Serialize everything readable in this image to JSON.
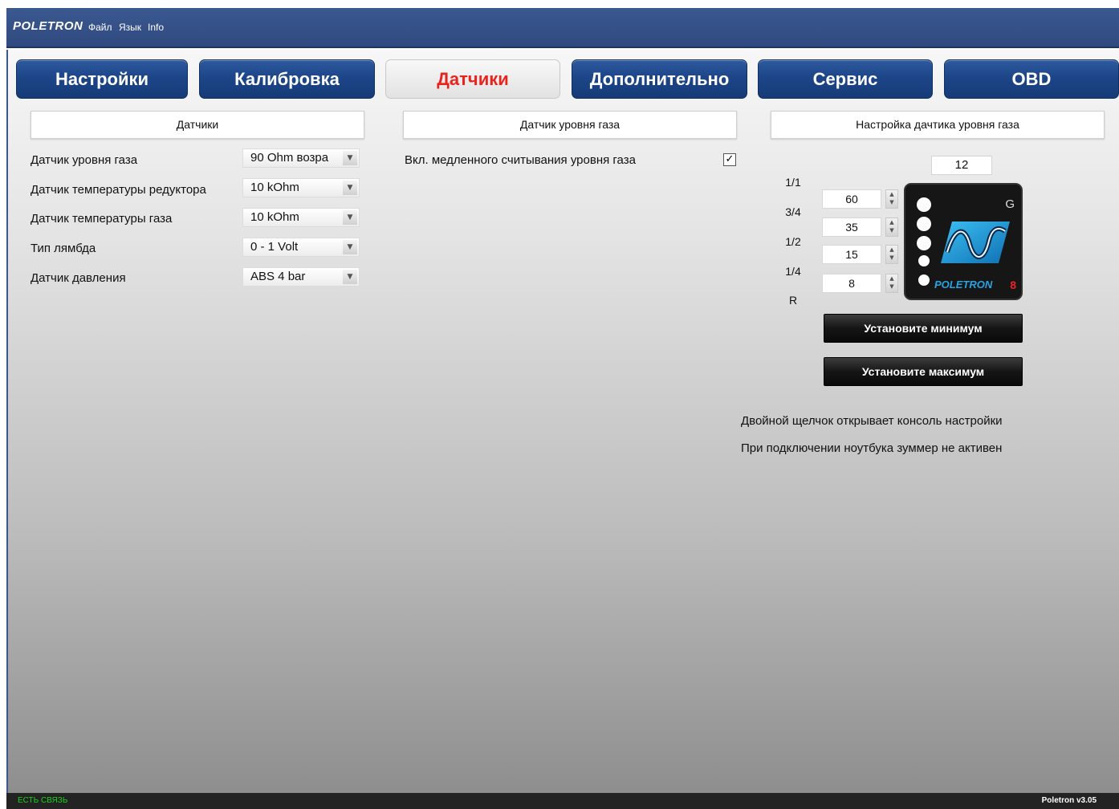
{
  "app": {
    "logo": "POLETRON",
    "menu": [
      "Файл",
      "Язык",
      "Info"
    ]
  },
  "tabs": [
    {
      "label": "Настройки",
      "active": false
    },
    {
      "label": "Калибровка",
      "active": false
    },
    {
      "label": "Датчики",
      "active": true
    },
    {
      "label": "Дополнительно",
      "active": false
    },
    {
      "label": "Сервис",
      "active": false
    },
    {
      "label": "OBD",
      "active": false
    }
  ],
  "sensors_panel": {
    "header": "Датчики",
    "rows": [
      {
        "label": "Датчик уровня газа",
        "value": "90 Ohm возра"
      },
      {
        "label": "Датчик температуры редуктора",
        "value": "10 kOhm"
      },
      {
        "label": "Датчик температуры газа",
        "value": "10 kOhm"
      },
      {
        "label": "Тип лямбда",
        "value": "0 - 1 Volt"
      },
      {
        "label": "Датчик давления",
        "value": "ABS 4 bar"
      }
    ]
  },
  "gas_level_panel": {
    "header": "Датчик уровня газа",
    "slow_read_label": "Вкл. медленного считывания уровня газа",
    "slow_read_checked": true,
    "checkmark": "✓"
  },
  "gas_sensor_setup": {
    "header": "Настройка дачтика уровня газа",
    "top_value": "12",
    "levels": [
      "1/1",
      "3/4",
      "1/2",
      "1/4",
      "R"
    ],
    "thresholds": [
      "60",
      "35",
      "15",
      "8"
    ],
    "device": {
      "g_label": "G",
      "brand": "POLETRON",
      "model": "8",
      "led_count": 5
    },
    "set_min_label": "Установите минимум",
    "set_max_label": "Установите максимум",
    "note_double_click": "Двойной щелчок открывает консоль настройки",
    "note_buzzer": "При подключении ноутбука зуммер не активен"
  },
  "status": {
    "connection": "ЕСТЬ СВЯЗЬ",
    "version": "Poletron v3.05"
  },
  "colors": {
    "tab_blue": "#1d4688",
    "active_tab_text": "#e8241e",
    "title_bar": "#34508a",
    "status_connected": "#1bd11b"
  }
}
